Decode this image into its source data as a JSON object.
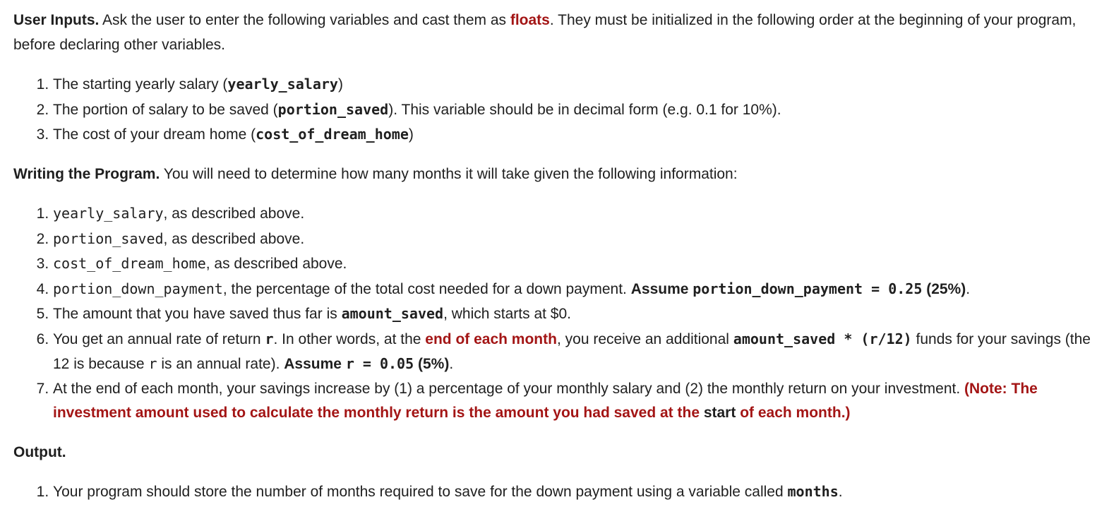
{
  "user_inputs": {
    "heading": "User Inputs.",
    "intro_1": " Ask the user to enter the following variables and cast them as ",
    "floats": "floats",
    "intro_2": ". They must be initialized in the following order at the beginning of your program, before declaring other variables.",
    "items": [
      {
        "pre": "The starting yearly salary (",
        "code": "yearly_salary",
        "post": ")"
      },
      {
        "pre": "The portion of salary to be saved (",
        "code": "portion_saved",
        "post": "). This variable should be in decimal form (e.g. 0.1 for 10%)."
      },
      {
        "pre": "The cost of your dream home (",
        "code": "cost_of_dream_home",
        "post": ")"
      }
    ]
  },
  "writing": {
    "heading": "Writing the Program.",
    "intro": " You will need to determine how many months it will take given the following information:",
    "item1": {
      "code": "yearly_salary",
      "post": ", as described above."
    },
    "item2": {
      "code": "portion_saved",
      "post": ", as described above."
    },
    "item3": {
      "code": "cost_of_dream_home",
      "post": ", as described above."
    },
    "item4": {
      "code": "portion_down_payment",
      "mid": ", the percentage of the total cost needed for a down payment. ",
      "assume": "Assume ",
      "assume_code": "portion_down_payment = 0.25",
      "assume_end": " (25%)",
      "end": "."
    },
    "item5": {
      "pre": "The amount that you have saved thus far is ",
      "code": "amount_saved",
      "post": ", which starts at $0."
    },
    "item6": {
      "pre": "You get an annual rate of return ",
      "code_r": "r",
      "mid1": ". In other words, at the ",
      "red": "end of each month",
      "mid2": ", you receive an additional ",
      "code_formula": "amount_saved * (r/12)",
      "mid3": " funds for your savings (the 12 is because ",
      "code_r2": "r",
      "mid4": " is an annual rate). ",
      "assume": "Assume ",
      "assume_code": "r = 0.05",
      "assume_end": " (5%)",
      "end": "."
    },
    "item7": {
      "pre": "At the end of each month, your savings increase by (1) a percentage of your monthly salary and (2) the monthly return on your investment. ",
      "note_1": "(Note: The investment amount used to calculate the monthly return is the amount you had saved at the ",
      "note_start": "start",
      "note_2": " of each month.)"
    }
  },
  "output": {
    "heading": "Output.",
    "item1": {
      "pre": "Your program should store the number of months required to save for the down payment using a variable called ",
      "code": "months",
      "post": "."
    }
  },
  "colors": {
    "text": "#1f1f1f",
    "accent_red": "#a31515"
  }
}
